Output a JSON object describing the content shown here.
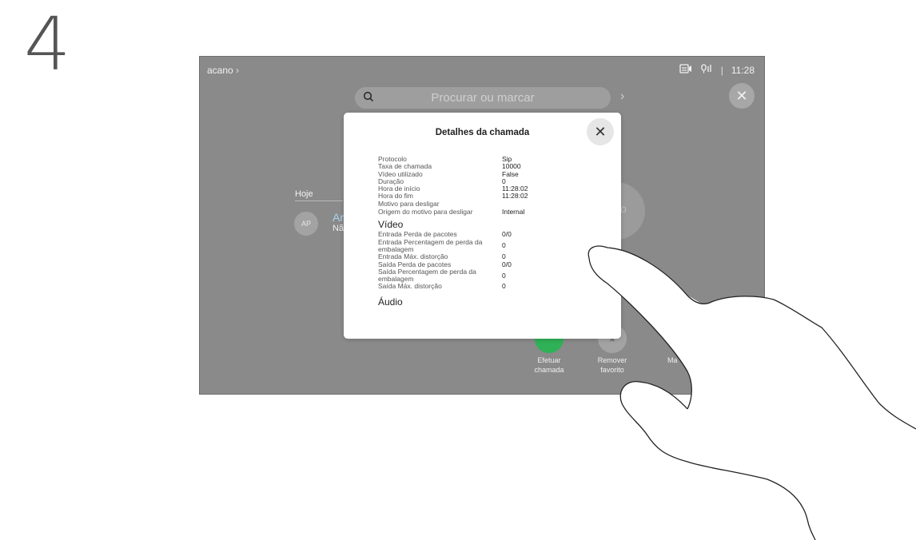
{
  "step_number": "4",
  "topbar": {
    "left_label": "acano",
    "time": "11:28",
    "separator": "|"
  },
  "search": {
    "placeholder": "Procurar ou marcar"
  },
  "history": {
    "section_label": "Hoje",
    "contact": {
      "initials": "AP",
      "name": "Ar",
      "sub": "Nã"
    }
  },
  "actions": {
    "call_line1": "Efetuar",
    "call_line2": "chamada",
    "remove_line1": "Remover",
    "remove_line2": "favorito",
    "more_label": "Ma"
  },
  "modal": {
    "title": "Detalhes da chamada",
    "general": [
      {
        "key": "Protocolo",
        "value": "Sip"
      },
      {
        "key": "Taxa de chamada",
        "value": "10000"
      },
      {
        "key": "Vídeo utilizado",
        "value": "False"
      },
      {
        "key": "Duração",
        "value": "0"
      },
      {
        "key": "Hora de início",
        "value": "11:28:02"
      },
      {
        "key": "Hora do fim",
        "value": "11:28:02"
      },
      {
        "key": "Motivo para desligar",
        "value": ""
      },
      {
        "key": "Origem do motivo para desligar",
        "value": "Internal"
      }
    ],
    "video_title": "Vídeo",
    "video": [
      {
        "key": "Entrada Perda de pacotes",
        "value": "0/0"
      },
      {
        "key": "Entrada Percentagem de perda da embalagem",
        "value": "0"
      },
      {
        "key": "Entrada Máx. distorção",
        "value": "0"
      },
      {
        "key": "Saída Perda de pacotes",
        "value": "0/0"
      },
      {
        "key": "Saída Percentagem de perda da embalagem",
        "value": "0"
      },
      {
        "key": "Saída Máx. distorção",
        "value": "0"
      }
    ],
    "audio_title": "Áudio"
  },
  "icons": {
    "camera": "camera-share-icon",
    "mic": "microphone-icon",
    "close": "close-icon",
    "search": "search-icon",
    "chevron": "chevron-right-icon"
  },
  "colors": {
    "call_green": "#2fb157",
    "contact_name": "#a6d4ef"
  }
}
